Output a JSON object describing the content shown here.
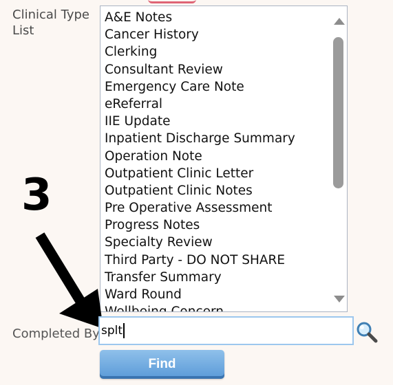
{
  "clinical_type": {
    "label": "Clinical Type List",
    "items": [
      "A&E Notes",
      "Cancer History",
      "Clerking",
      "Consultant Review",
      "Emergency Care Note",
      "eReferral",
      "IIE Update",
      "Inpatient Discharge Summary",
      "Operation Note",
      "Outpatient Clinic Letter",
      "Outpatient Clinic Notes",
      "Pre Operative Assessment",
      "Progress Notes",
      "Specialty Review",
      "Third Party - DO NOT SHARE",
      "Transfer Summary",
      "Ward Round",
      "Wellbeing Concern"
    ]
  },
  "completed_by": {
    "label": "Completed By:",
    "value": "splt"
  },
  "find_button": {
    "label": "Find"
  },
  "annotation": {
    "step_number": "3"
  },
  "icons": {
    "search": "magnifier-icon"
  },
  "colors": {
    "input_border": "#9cc7ee",
    "button": "#6aa7de",
    "accent": "#d6334b"
  }
}
